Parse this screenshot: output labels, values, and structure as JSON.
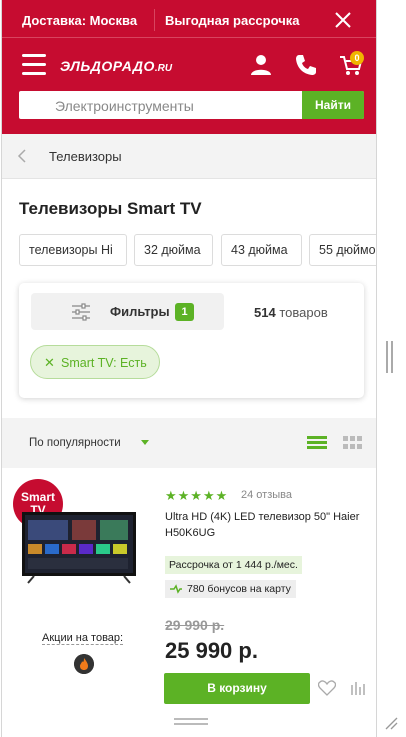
{
  "topbar": {
    "delivery": "Доставка: Москва",
    "installment": "Выгодная рассрочка"
  },
  "header": {
    "logo": "ЭЛЬДОРАДО",
    "logo_suffix": ".RU",
    "cart_count": "0",
    "search_placeholder": "Электроинструменты",
    "search_button": "Найти"
  },
  "breadcrumb": {
    "label": "Телевизоры"
  },
  "page_title": "Телевизоры Smart TV",
  "chips": [
    "телевизоры Hi",
    "32 дюйма",
    "43 дюйма",
    "55 дюймо"
  ],
  "filters": {
    "label": "Фильтры",
    "count": "1",
    "goods_count": "514",
    "goods_word": "товаров",
    "active_tag": "Smart TV: Есть"
  },
  "sort": {
    "label": "По популярности"
  },
  "product": {
    "badge": "Smart TV",
    "rating": 5,
    "reviews": "24 отзыва",
    "name": "Ultra HD (4K) LED телевизор 50\" Haier H50K6UG",
    "installment": "Рассрочка от 1 444 р./мес.",
    "bonus": "780 бонусов на карту",
    "old_price": "29 990 р.",
    "price": "25 990 р.",
    "promo": "Акции на товар:",
    "buy_button": "В корзину"
  },
  "colors": {
    "brand_red": "#c60c30",
    "accent_green": "#5cb225"
  }
}
